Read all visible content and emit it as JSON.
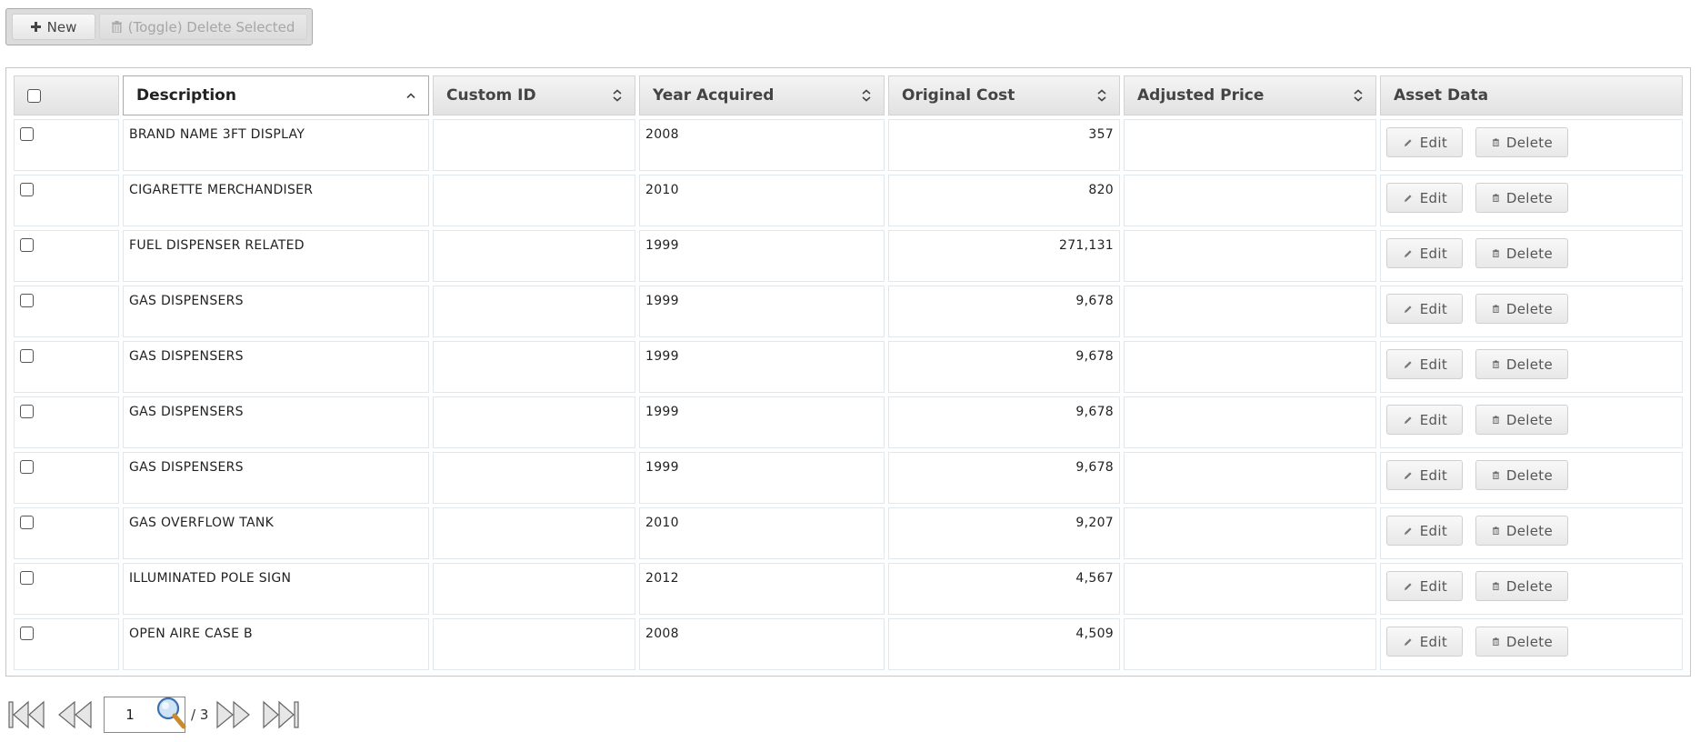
{
  "toolbar": {
    "new_label": "New",
    "delete_selected_label": "(Toggle) Delete Selected"
  },
  "table": {
    "columns": {
      "description": "Description",
      "custom_id": "Custom ID",
      "year_acquired": "Year Acquired",
      "original_cost": "Original Cost",
      "adjusted_price": "Adjusted Price",
      "asset_data": "Asset Data"
    },
    "sorted_column": "Description",
    "sort_direction": "ascending",
    "edit_label": "Edit",
    "delete_label": "Delete",
    "rows": [
      {
        "description": "BRAND NAME 3FT DISPLAY",
        "custom_id": "",
        "year": "2008",
        "cost": "357",
        "adjusted": ""
      },
      {
        "description": "CIGARETTE MERCHANDISER",
        "custom_id": "",
        "year": "2010",
        "cost": "820",
        "adjusted": ""
      },
      {
        "description": "FUEL DISPENSER RELATED",
        "custom_id": "",
        "year": "1999",
        "cost": "271,131",
        "adjusted": ""
      },
      {
        "description": "GAS DISPENSERS",
        "custom_id": "",
        "year": "1999",
        "cost": "9,678",
        "adjusted": ""
      },
      {
        "description": "GAS DISPENSERS",
        "custom_id": "",
        "year": "1999",
        "cost": "9,678",
        "adjusted": ""
      },
      {
        "description": "GAS DISPENSERS",
        "custom_id": "",
        "year": "1999",
        "cost": "9,678",
        "adjusted": ""
      },
      {
        "description": "GAS DISPENSERS",
        "custom_id": "",
        "year": "1999",
        "cost": "9,678",
        "adjusted": ""
      },
      {
        "description": "GAS OVERFLOW TANK",
        "custom_id": "",
        "year": "2010",
        "cost": "9,207",
        "adjusted": ""
      },
      {
        "description": "ILLUMINATED POLE SIGN",
        "custom_id": "",
        "year": "2012",
        "cost": "4,567",
        "adjusted": ""
      },
      {
        "description": "OPEN AIRE CASE B",
        "custom_id": "",
        "year": "2008",
        "cost": "4,509",
        "adjusted": ""
      }
    ]
  },
  "pager": {
    "current_page": "1",
    "total_label": "/ 3"
  },
  "colors": {
    "header_bg": "#e8e8e8",
    "cell_border": "#e0e8ee",
    "button_border": "#cfcfcf"
  }
}
